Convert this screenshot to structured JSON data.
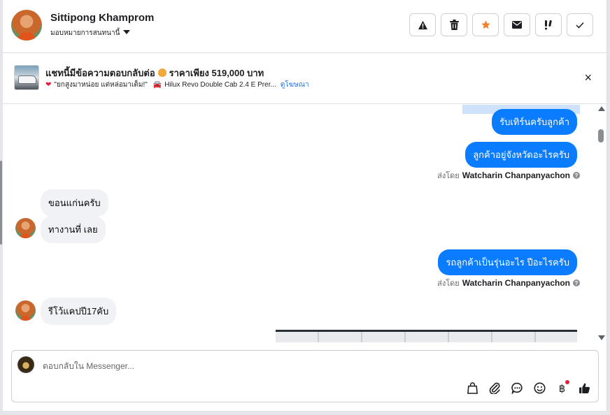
{
  "header": {
    "user_name": "Sittipong Khamprom",
    "assign_label": "มอบหมายการสนทนานี้",
    "actions": [
      {
        "name": "report",
        "icon": "warning-icon",
        "glyph": "⚠"
      },
      {
        "name": "delete",
        "icon": "trash-icon",
        "glyph": "🗑"
      },
      {
        "name": "star",
        "icon": "star-icon",
        "glyph": "★"
      },
      {
        "name": "mark-unread",
        "icon": "envelope-icon",
        "glyph": "✉"
      },
      {
        "name": "follow-up",
        "icon": "exclamation-icon",
        "glyph": "!!"
      },
      {
        "name": "mark-done",
        "icon": "check-icon",
        "glyph": "✓"
      }
    ]
  },
  "ad": {
    "title": "แชทนี้มีข้อความตอบกลับต่อ",
    "price": "ราคาเพียง 519,000 บาท",
    "subtitle": "\"ยกสูงมาหน่อย แต่หล่อมาเต็ม!\"",
    "vehicle": "Hilux Revo Double Cab 2.4 E Prer...",
    "link": "ดูโฆษณา",
    "close": "×"
  },
  "messages": [
    {
      "dir": "out",
      "text": "รับเทิร์นครับลูกค้า"
    },
    {
      "dir": "out",
      "text": "ลูกค้าอยู่จังหวัดอะไรครับ",
      "sent_by_label": "ส่งโดย",
      "sent_by": "Watcharin Chanpanyachon"
    },
    {
      "dir": "in",
      "text": "ขอนแก่นครับ"
    },
    {
      "dir": "in",
      "text": "ทางานที่ เลย"
    },
    {
      "dir": "out",
      "text": "รถลูกค้าเป็นรุ่นอะไร ปีอะไรครับ",
      "sent_by_label": "ส่งโดย",
      "sent_by": "Watcharin Chanpanyachon"
    },
    {
      "dir": "in",
      "text": "รีโว้แคปปี17คับ"
    }
  ],
  "composer": {
    "placeholder": "ตอบกลับใน Messenger...",
    "tools": [
      "bag-icon",
      "paperclip-icon",
      "chat-bubble-icon",
      "emoji-icon",
      "baht-icon",
      "thumbs-up-icon"
    ]
  },
  "colors": {
    "outgoing_bubble": "#0a7cff",
    "incoming_bubble": "#f0f2f5",
    "star": "#f4802a",
    "notification_dot": "#e41e3f",
    "link": "#216fdb"
  }
}
